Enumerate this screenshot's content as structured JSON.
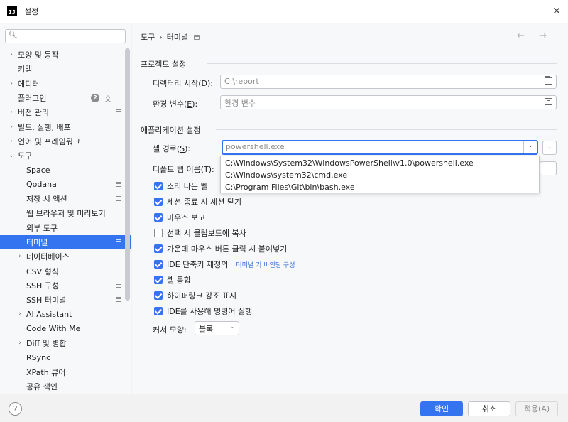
{
  "window": {
    "title": "설정",
    "app_icon_text": "IJ"
  },
  "search": {
    "placeholder": ""
  },
  "sidebar": {
    "items": [
      {
        "label": "모양 및 동작",
        "chevron": "›"
      },
      {
        "label": "키맵"
      },
      {
        "label": "에디터",
        "chevron": "›"
      },
      {
        "label": "플러그인",
        "badge": "2"
      },
      {
        "label": "버전 관리",
        "chevron": "›"
      },
      {
        "label": "빌드, 실행, 배포",
        "chevron": "›"
      },
      {
        "label": "언어 및 프레임워크",
        "chevron": "›"
      },
      {
        "label": "도구",
        "chevron": "⌄"
      },
      {
        "label": "Space"
      },
      {
        "label": "Qodana"
      },
      {
        "label": "저장 시 액션"
      },
      {
        "label": "웹 브라우저 및 미리보기"
      },
      {
        "label": "외부 도구"
      },
      {
        "label": "터미널"
      },
      {
        "label": "데이터베이스",
        "chevron": "›"
      },
      {
        "label": "CSV 형식"
      },
      {
        "label": "SSH 구성"
      },
      {
        "label": "SSH 터미널"
      },
      {
        "label": "AI Assistant",
        "chevron": "›"
      },
      {
        "label": "Code With Me"
      },
      {
        "label": "Diff 및 병합",
        "chevron": "›"
      },
      {
        "label": "RSync"
      },
      {
        "label": "XPath 뷰어"
      },
      {
        "label": "공유 색인"
      }
    ]
  },
  "breadcrumb": {
    "parent": "도구",
    "separator": "›",
    "current": "터미널"
  },
  "nav_arrows": "← →",
  "project_settings": {
    "title": "프로젝트 설정",
    "start_dir_label": "디렉터리 시작(",
    "start_dir_mnemonic": "D",
    "start_dir_suffix": "):",
    "start_dir_value": "C:\\report",
    "env_label": "환경 변수(",
    "env_mnemonic": "E",
    "env_suffix": "):",
    "env_placeholder": "환경 변수"
  },
  "app_settings": {
    "title": "애플리케이션 설정",
    "shell_label": "셸 경로(",
    "shell_mnemonic": "S",
    "shell_suffix": "):",
    "shell_value": "powershell.exe",
    "browse_label": "...",
    "shell_options": [
      "C:\\Windows\\System32\\WindowsPowerShell\\v1.0\\powershell.exe",
      "C:\\Windows\\system32\\cmd.exe",
      "C:\\Program Files\\Git\\bin\\bash.exe"
    ],
    "tab_name_label": "디폴트 탭 이름(",
    "tab_name_mnemonic": "T",
    "tab_name_suffix": "):"
  },
  "checkboxes": [
    {
      "label": "소리 나는 벨",
      "checked": true
    },
    {
      "label": "세션 종료 시 세션 닫기",
      "checked": true
    },
    {
      "label": "마우스 보고",
      "checked": true
    },
    {
      "label": "선택 시 클립보드에 복사",
      "checked": false
    },
    {
      "label": "가운데 마우스 버튼 클릭 시 붙여넣기",
      "checked": true
    },
    {
      "label": "IDE 단축키 재정의",
      "checked": true,
      "link": "터미널 키 바인딩 구성"
    },
    {
      "label": "셸 통합",
      "checked": true
    },
    {
      "label": "하이퍼링크 강조 표시",
      "checked": true
    },
    {
      "label": "IDE를 사용해 명령어 실행",
      "checked": true
    }
  ],
  "cursor_shape": {
    "label": "커서 모양:",
    "value": "블록"
  },
  "footer": {
    "help": "?",
    "ok": "확인",
    "cancel": "취소",
    "apply": "적용(A)"
  },
  "colors": {
    "accent": "#3574f0",
    "link": "#2f6cd6",
    "sidebar_bg": "#f7f8fa"
  }
}
